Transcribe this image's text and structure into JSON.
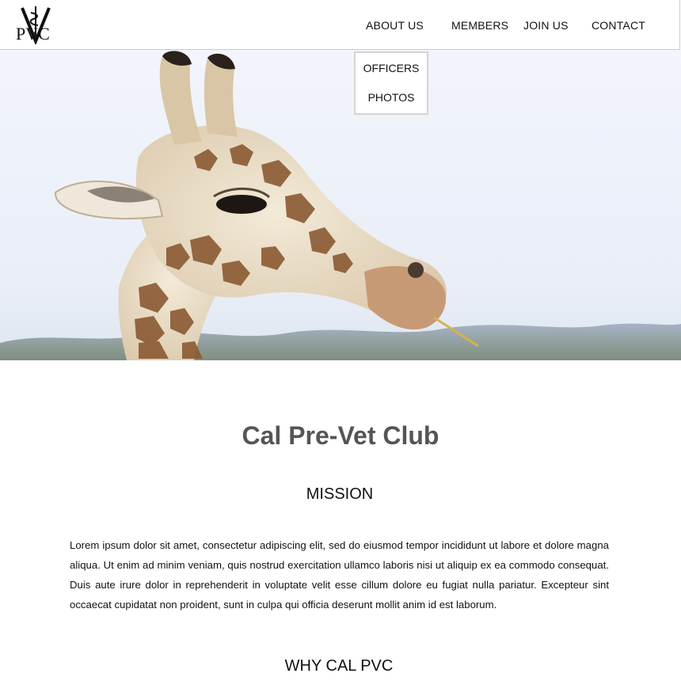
{
  "header": {
    "logo_text": "PVC",
    "nav": {
      "about": "ABOUT US",
      "members": "MEMBERS",
      "join": "JOIN US",
      "contact": "CONTACT"
    },
    "dropdown": {
      "officers": "OFFICERS",
      "photos": "PHOTOS"
    }
  },
  "hero": {
    "image_subject": "giraffe",
    "slides_count": 4,
    "active_slide": 1
  },
  "content": {
    "title": "Cal Pre-Vet Club",
    "mission_heading": "MISSION",
    "mission_text": "Lorem ipsum dolor sit amet, consectetur adipiscing elit, sed do eiusmod tempor incididunt ut labore et dolore magna aliqua. Ut enim ad minim veniam, quis nostrud exercitation ullamco laboris nisi ut aliquip ex ea commodo consequat. Duis aute irure dolor in reprehenderit in voluptate velit esse cillum dolore eu fugiat nulla pariatur. Excepteur sint occaecat cupidatat non proident, sunt in culpa qui officia deserunt mollit anim id est laborum.",
    "why_heading": "WHY CAL PVC"
  },
  "colors": {
    "title": "#555555",
    "border": "#c9c9c9",
    "dot": "#d0d0d0"
  }
}
